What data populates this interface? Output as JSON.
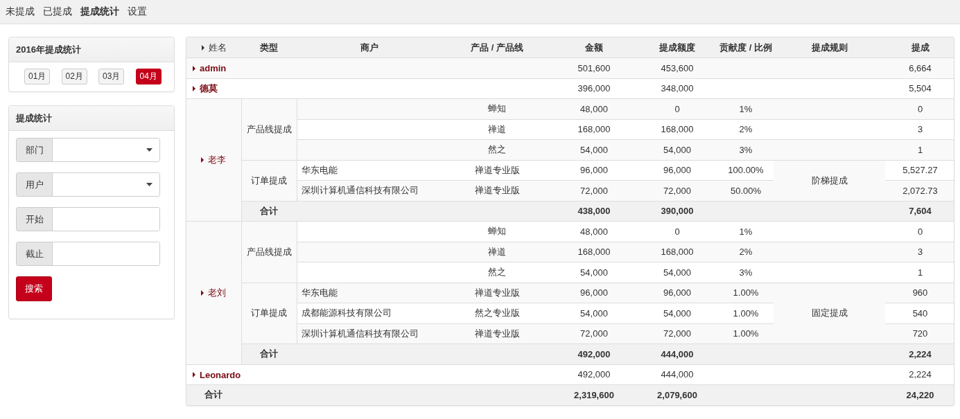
{
  "nav": [
    {
      "label": "未提成",
      "selected": false
    },
    {
      "label": "已提成",
      "selected": false
    },
    {
      "label": "提成统计",
      "selected": true
    },
    {
      "label": "设置",
      "selected": false
    }
  ],
  "month_panel": {
    "title": "2016年提成统计",
    "months": [
      {
        "label": "01月",
        "selected": false
      },
      {
        "label": "02月",
        "selected": false
      },
      {
        "label": "03月",
        "selected": false
      },
      {
        "label": "04月",
        "selected": true
      }
    ]
  },
  "filter_panel": {
    "title": "提成统计",
    "fields": [
      {
        "label": "部门",
        "kind": "select"
      },
      {
        "label": "用户",
        "kind": "select"
      },
      {
        "label": "开始",
        "kind": "text"
      },
      {
        "label": "截止",
        "kind": "text"
      }
    ],
    "search_button": "搜索"
  },
  "table": {
    "columns": [
      "姓名",
      "类型",
      "商户",
      "产品 / 产品线",
      "金额",
      "提成额度",
      "贡献度 / 比例",
      "提成规则",
      "提成"
    ],
    "people": [
      {
        "name": "admin",
        "expanded": false,
        "amount": "501,600",
        "quota": "453,600",
        "commission": "6,664"
      },
      {
        "name": "德莫",
        "expanded": false,
        "amount": "396,000",
        "quota": "348,000",
        "commission": "5,504"
      },
      {
        "name": "老李",
        "expanded": true,
        "groups": [
          {
            "type": "产品线提成",
            "items": [
              {
                "product": "蝉知",
                "amount": "48,000",
                "quota": "0",
                "ratio": "1%",
                "commission": "0"
              },
              {
                "product": "禅道",
                "amount": "168,000",
                "quota": "168,000",
                "ratio": "2%",
                "commission": "3"
              },
              {
                "product": "然之",
                "amount": "54,000",
                "quota": "54,000",
                "ratio": "3%",
                "commission": "1"
              }
            ]
          },
          {
            "type": "订单提成",
            "rule": "阶梯提成",
            "items": [
              {
                "merchant": "华东电能",
                "product": "禅道专业版",
                "amount": "96,000",
                "quota": "96,000",
                "ratio": "100.00%",
                "commission": "5,527.27"
              },
              {
                "merchant": "深圳计算机通信科技有限公司",
                "product": "禅道专业版",
                "amount": "72,000",
                "quota": "72,000",
                "ratio": "50.00%",
                "commission": "2,072.73"
              }
            ]
          }
        ],
        "total": {
          "label": "合计",
          "amount": "438,000",
          "quota": "390,000",
          "commission": "7,604"
        }
      },
      {
        "name": "老刘",
        "expanded": true,
        "groups": [
          {
            "type": "产品线提成",
            "items": [
              {
                "product": "蝉知",
                "amount": "48,000",
                "quota": "0",
                "ratio": "1%",
                "commission": "0"
              },
              {
                "product": "禅道",
                "amount": "168,000",
                "quota": "168,000",
                "ratio": "2%",
                "commission": "3"
              },
              {
                "product": "然之",
                "amount": "54,000",
                "quota": "54,000",
                "ratio": "3%",
                "commission": "1"
              }
            ]
          },
          {
            "type": "订单提成",
            "rule": "固定提成",
            "items": [
              {
                "merchant": "华东电能",
                "product": "禅道专业版",
                "amount": "96,000",
                "quota": "96,000",
                "ratio": "1.00%",
                "commission": "960"
              },
              {
                "merchant": "成都能源科技有限公司",
                "product": "然之专业版",
                "amount": "54,000",
                "quota": "54,000",
                "ratio": "1.00%",
                "commission": "540"
              },
              {
                "merchant": "深圳计算机通信科技有限公司",
                "product": "禅道专业版",
                "amount": "72,000",
                "quota": "72,000",
                "ratio": "1.00%",
                "commission": "720"
              }
            ]
          }
        ],
        "total": {
          "label": "合计",
          "amount": "492,000",
          "quota": "444,000",
          "commission": "2,224"
        }
      },
      {
        "name": "Leonardo",
        "expanded": false,
        "amount": "492,000",
        "quota": "444,000",
        "commission": "2,224"
      }
    ],
    "grand_total": {
      "label": "合计",
      "amount": "2,319,600",
      "quota": "2,079,600",
      "commission": "24,220"
    }
  }
}
